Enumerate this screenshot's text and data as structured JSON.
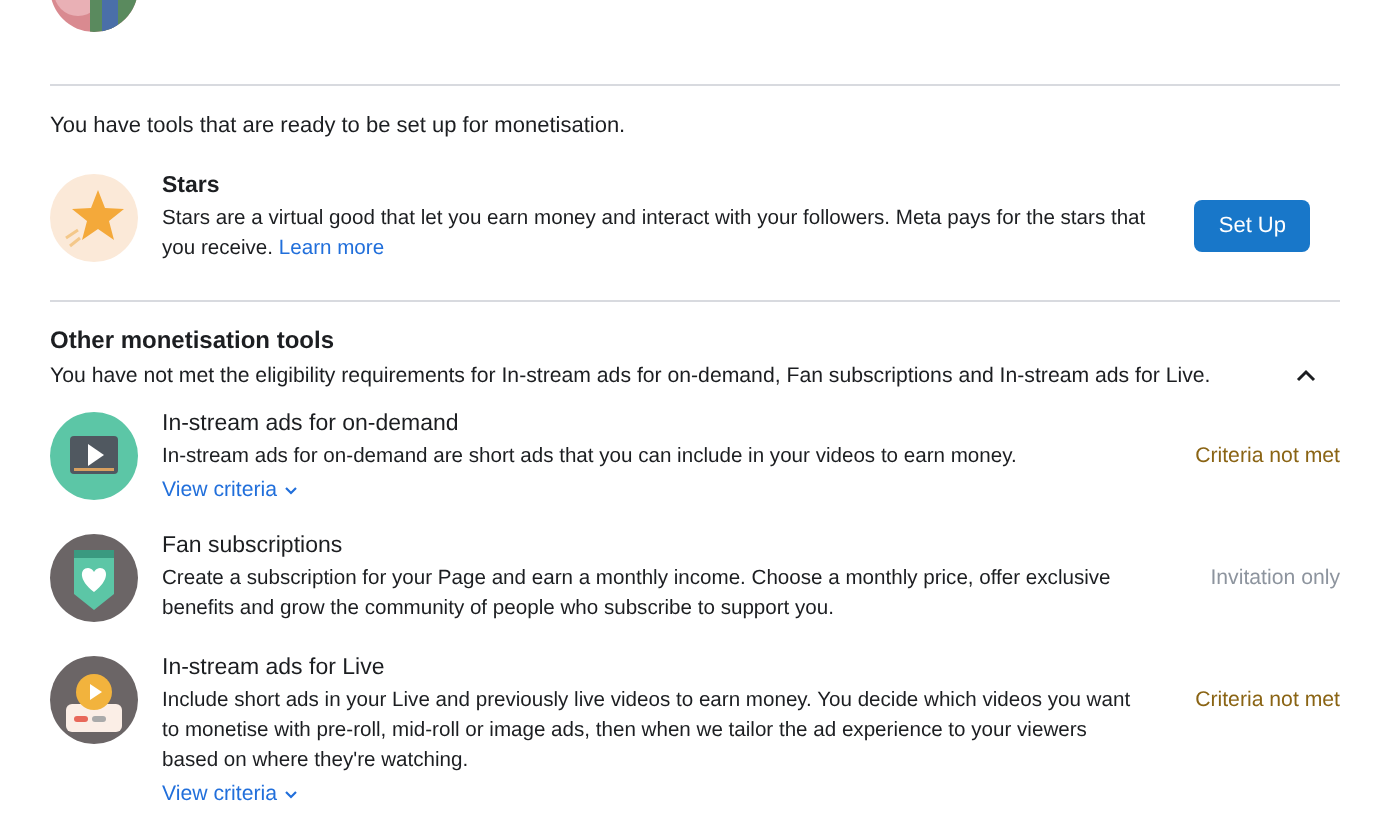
{
  "ready_section": {
    "intro": "You have tools that are ready to be set up for monetisation.",
    "tool": {
      "title": "Stars",
      "description": "Stars are a virtual good that let you earn money and interact with your followers. Meta pays for the stars that you receive.",
      "link": "Learn more",
      "button": "Set Up"
    }
  },
  "other_section": {
    "heading": "Other monetisation tools",
    "subtitle": "You have not met the eligibility requirements for In-stream ads for on-demand, Fan subscriptions and In-stream ads for Live.",
    "expanded": true,
    "tools": [
      {
        "kind": "video",
        "title": "In-stream ads for on-demand",
        "description": "In-stream ads for on-demand are short ads that you can include in your videos to earn money.",
        "link": "View criteria",
        "status": "Criteria not met",
        "color": "#8a6414"
      },
      {
        "kind": "heart",
        "title": "Fan subscriptions",
        "description": "Create a subscription for your Page and earn a monthly income. Choose a monthly price, offer exclusive benefits and grow the community of people who subscribe to support you.",
        "status": "Invitation only",
        "color": "#8d949e"
      },
      {
        "kind": "live",
        "title": "In-stream ads for Live",
        "description": "Include short ads in your Live and previously live videos to earn money. You decide which videos you want to monetise with pre-roll, mid-roll or image ads, then when we tailor the ad experience to your viewers based on where they're watching.",
        "link": "View criteria",
        "status": "Criteria not met",
        "color": "#8a6414"
      }
    ]
  }
}
